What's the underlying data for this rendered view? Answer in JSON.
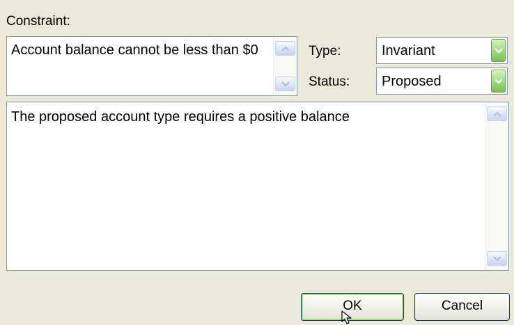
{
  "constraint": {
    "label": "Constraint:",
    "text": "Account balance cannot be less than $0"
  },
  "type_field": {
    "label": "Type:",
    "value": "Invariant"
  },
  "status_field": {
    "label": "Status:",
    "value": "Proposed"
  },
  "notes": {
    "text": "The proposed account type requires a positive balance"
  },
  "buttons": {
    "ok": "OK",
    "cancel": "Cancel"
  },
  "colors": {
    "dialog_background": "#ece9d8",
    "field_border": "#7f9db9",
    "dropdown_button": "#a4df86",
    "button_border": "#003c74"
  },
  "icons": {
    "scroll_up": "scroll-up-arrow-icon",
    "scroll_down": "scroll-down-arrow-icon",
    "dropdown": "chevron-down-icon",
    "cursor": "mouse-cursor-icon"
  }
}
